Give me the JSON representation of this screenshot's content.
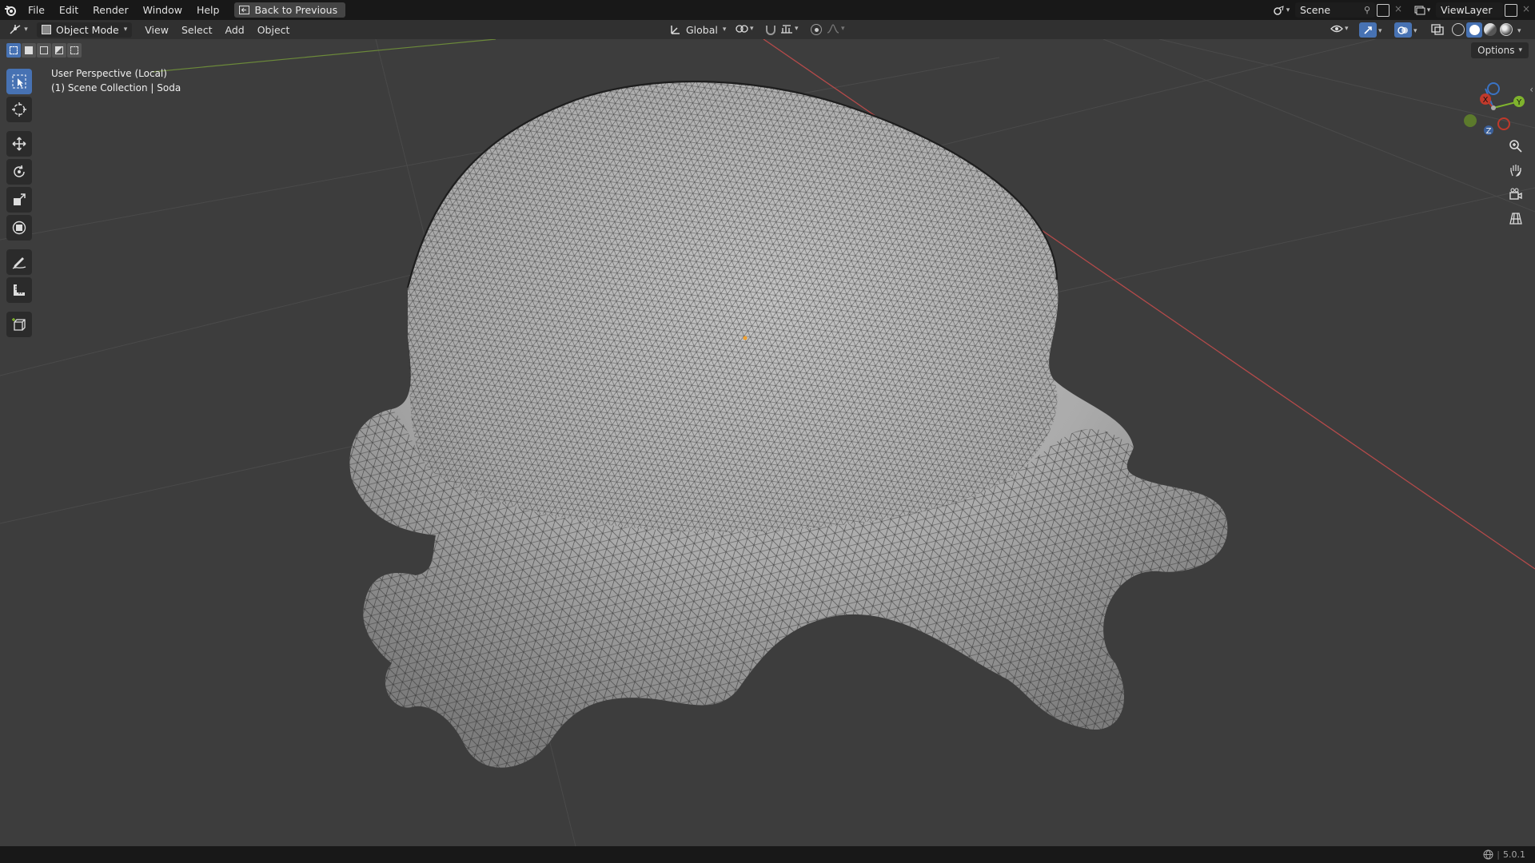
{
  "topbar": {
    "menus": [
      "File",
      "Edit",
      "Render",
      "Window",
      "Help"
    ],
    "back_label": "Back to Previous",
    "scene_label": "Scene",
    "viewlayer_label": "ViewLayer"
  },
  "header": {
    "mode_label": "Object Mode",
    "menus": [
      "View",
      "Select",
      "Add",
      "Object"
    ],
    "transform_orientation": "Global"
  },
  "viewport": {
    "perspective_label": "User Perspective (Local)",
    "collection_label": "(1) Scene Collection | Soda",
    "options_label": "Options"
  },
  "gizmo": {
    "x": "X",
    "y": "Y",
    "z": "Z"
  },
  "status": {
    "version": "5.0.1"
  },
  "colors": {
    "accent": "#4772b3",
    "x_axis": "#c0392b",
    "y_axis": "#7fb32d",
    "z_axis": "#3a73c4",
    "mesh": "#a9a9a9"
  }
}
